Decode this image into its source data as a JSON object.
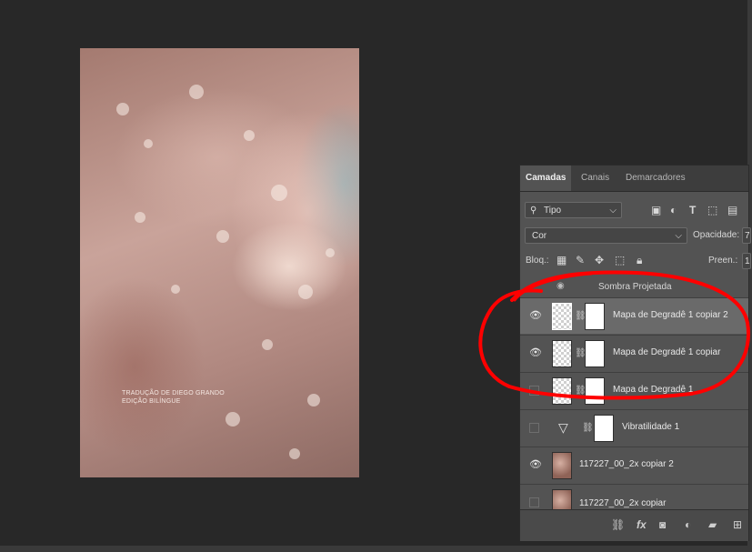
{
  "document": {
    "text_line1": "TRADUÇÃO DE DIEGO GRANDO",
    "text_line2": "EDIÇÃO BILÍNGUE"
  },
  "panel": {
    "tabs": [
      "Camadas",
      "Canais",
      "Demarcadores"
    ],
    "filter_label": "Tipo",
    "blend_mode": "Cor",
    "opacity_label": "Opacidade:",
    "opacity_value": "7",
    "lock_label": "Bloq.:",
    "fill_label": "Preen.:",
    "fill_value": "1",
    "effect_name": "Sombra Projetada",
    "layers": [
      {
        "name": "Mapa de Degradê 1 copiar 2",
        "visible": true,
        "selected": true
      },
      {
        "name": "Mapa de Degradê 1 copiar",
        "visible": true
      },
      {
        "name": "Mapa de Degradê 1",
        "visible": false
      },
      {
        "name": "Vibratilidade 1",
        "visible": false
      },
      {
        "name": "117227_00_2x copiar 2",
        "visible": true
      },
      {
        "name": "117227_00_2x copiar",
        "visible": false
      }
    ],
    "footer_icons": [
      "link-icon",
      "fx-icon",
      "mask-icon",
      "adjustment-icon",
      "folder-icon",
      "new-layer-icon"
    ]
  },
  "annotation": {
    "color": "#ff0000"
  }
}
